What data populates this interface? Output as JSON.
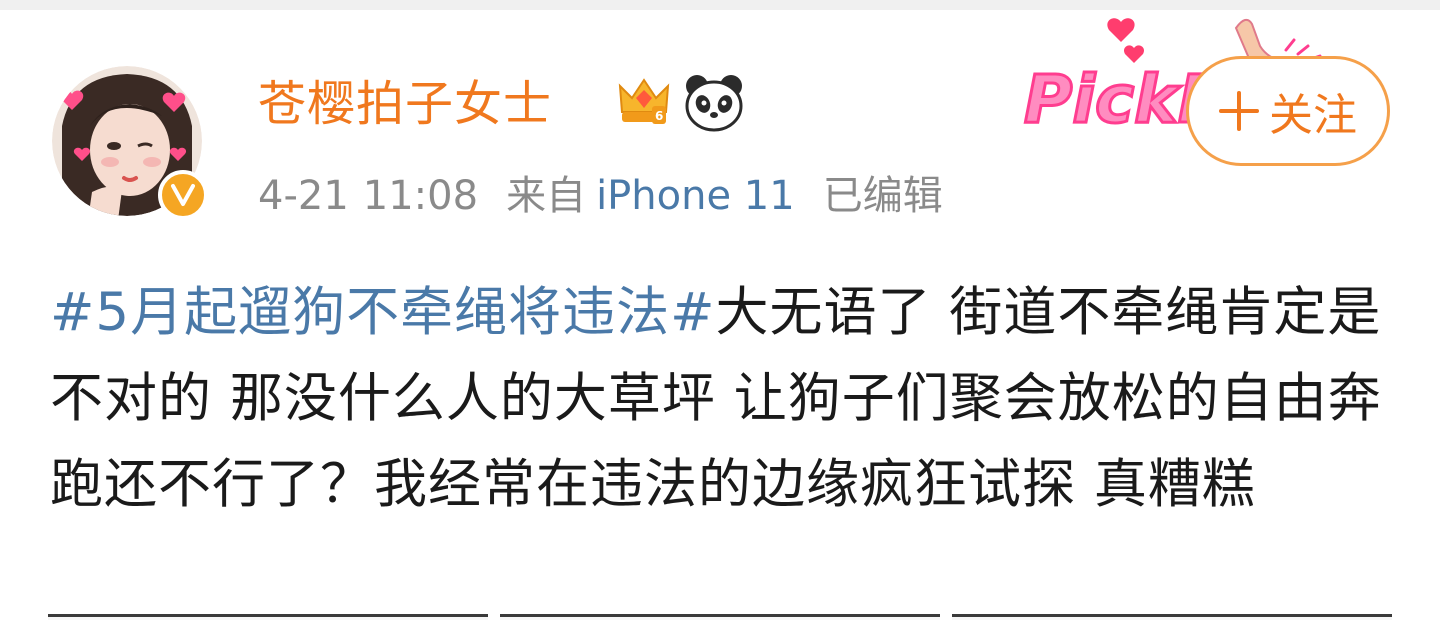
{
  "user": {
    "name": "苍樱拍子女士",
    "verified": true,
    "badges": [
      "crown-level-6-icon",
      "panda-icon"
    ]
  },
  "post": {
    "date": "4-21",
    "time": "11:08",
    "source_label": "来自",
    "source_device": "iPhone 11",
    "edited": "已编辑",
    "hashtag": "#5月起遛狗不牵绳将违法#",
    "text": "大无语了 街道不牵绳肯定是不对的 那没什么人的大草坪 让狗子们聚会放松的自由奔跑还不行了？我经常在违法的边缘疯狂试探 真糟糕"
  },
  "follow_button": {
    "label": "关注"
  },
  "sticker": {
    "text": "PickMe"
  },
  "colors": {
    "username": "#f0781e",
    "link": "#4a79a8",
    "meta": "#8a8a8a",
    "follow_border": "#f5a04a",
    "verified": "#f5a623",
    "sticker_pink": "#ff5fa2"
  }
}
